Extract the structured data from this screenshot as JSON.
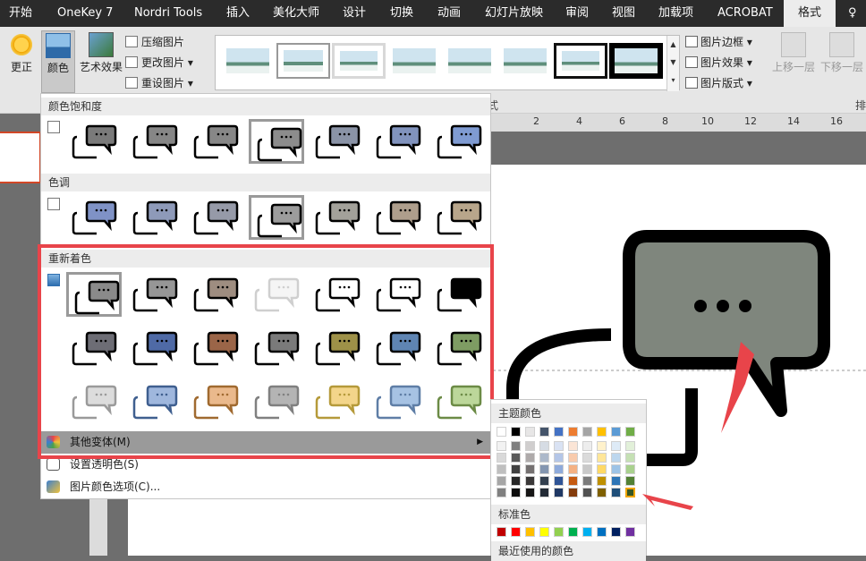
{
  "tabs": [
    {
      "label": "开始"
    },
    {
      "label": "OneKey 7"
    },
    {
      "label": "Nordri Tools"
    },
    {
      "label": "插入"
    },
    {
      "label": "美化大师"
    },
    {
      "label": "设计"
    },
    {
      "label": "切换"
    },
    {
      "label": "动画"
    },
    {
      "label": "幻灯片放映"
    },
    {
      "label": "审阅"
    },
    {
      "label": "视图"
    },
    {
      "label": "加载项"
    },
    {
      "label": "ACROBAT"
    },
    {
      "label": "格式"
    },
    {
      "label": "♀"
    }
  ],
  "ribbon": {
    "correct_label": "更正",
    "color_label": "颜色",
    "artistic_label": "艺术效果",
    "compress_label": "压缩图片",
    "change_label": "更改图片",
    "reset_label": "重设图片",
    "style_group_label": "式",
    "border_label": "图片边框",
    "effects_label": "图片效果",
    "layout_label": "图片版式",
    "bring_forward_label": "上移一层",
    "send_backward_label": "下移一层",
    "arrange_label": "排",
    "gallery_count": 8
  },
  "ruler": {
    "ticks": [
      "2",
      "4",
      "6",
      "8",
      "10",
      "12",
      "14",
      "16"
    ]
  },
  "dropdown": {
    "saturation_title": "颜色饱和度",
    "tone_title": "色调",
    "recolor_title": "重新着色",
    "more_variations": "其他变体(M)",
    "set_transparent": "设置透明色(S)",
    "picture_color_options": "图片颜色选项(C)...",
    "saturation_fills": [
      "#7a7a7a",
      "#868686",
      "#878787",
      "#8c8c8c",
      "#8a93a6",
      "#8193bd",
      "#7f9bd2"
    ],
    "tone_fills": [
      "#7f92c6",
      "#8e9ab9",
      "#969aa8",
      "#9c9c9c",
      "#a3a19a",
      "#ae9e8c",
      "#b8a68b"
    ],
    "recolor_rows": [
      {
        "fills": [
          "#8a8a8a",
          "#969696",
          "#9e8d80",
          "#f5f5f5",
          "#ffffff",
          "#ffffff",
          "#000000"
        ],
        "strokes": [
          "#000",
          "#000",
          "#000",
          "#cfcfcf",
          "#000",
          "#000",
          "#000"
        ]
      },
      {
        "fills": [
          "#6d6d75",
          "#4f6aa6",
          "#9b6548",
          "#7a7a7a",
          "#9e9148",
          "#5f85b3",
          "#7e9c63"
        ],
        "strokes": [
          "#000",
          "#000",
          "#000",
          "#000",
          "#000",
          "#000",
          "#000"
        ]
      },
      {
        "fills": [
          "#dcdcdc",
          "#9fb7dd",
          "#eab98c",
          "#b4b4b4",
          "#f3d58a",
          "#a6c2e3",
          "#bcd79a"
        ],
        "strokes": [
          "#9a9a9a",
          "#3f5f8f",
          "#a06a30",
          "#808080",
          "#b59a3a",
          "#5f7ea6",
          "#6c8b46"
        ]
      }
    ]
  },
  "color_popup": {
    "theme_title": "主题颜色",
    "standard_title": "标准色",
    "recent_title": "最近使用的颜色",
    "theme_top": [
      "#ffffff",
      "#000000",
      "#e7e6e6",
      "#44546a",
      "#4472c4",
      "#ed7d31",
      "#a5a5a5",
      "#ffc000",
      "#5b9bd5",
      "#70ad47"
    ],
    "theme_shades": [
      [
        "#f2f2f2",
        "#d9d9d9",
        "#bfbfbf",
        "#a6a6a6",
        "#808080"
      ],
      [
        "#7f7f7f",
        "#595959",
        "#404040",
        "#262626",
        "#0d0d0d"
      ],
      [
        "#d0cece",
        "#aeaaaa",
        "#757171",
        "#3a3838",
        "#171616"
      ],
      [
        "#d6dce4",
        "#adb9ca",
        "#8496b0",
        "#333f4f",
        "#222a35"
      ],
      [
        "#d9e2f3",
        "#b4c6e7",
        "#8eaadb",
        "#2f5496",
        "#1f3864"
      ],
      [
        "#fbe5d6",
        "#f8cbad",
        "#f4b183",
        "#c55a11",
        "#843c0c"
      ],
      [
        "#ededed",
        "#dbdbdb",
        "#c9c9c9",
        "#7b7b7b",
        "#525252"
      ],
      [
        "#fff2cc",
        "#ffe699",
        "#ffd966",
        "#bf9000",
        "#7f6000"
      ],
      [
        "#deebf7",
        "#bdd7ee",
        "#9dc3e6",
        "#2e75b6",
        "#1f4e79"
      ],
      [
        "#e2f0d9",
        "#c5e0b4",
        "#a9d18e",
        "#538135",
        "#375623"
      ]
    ],
    "standard": [
      "#c00000",
      "#ff0000",
      "#ffc000",
      "#ffff00",
      "#92d050",
      "#00b050",
      "#00b0f0",
      "#0070c0",
      "#002060",
      "#7030a0"
    ]
  },
  "slide": {
    "bubble_fill": "#7f867d",
    "arrow_color": "#e8444a"
  }
}
